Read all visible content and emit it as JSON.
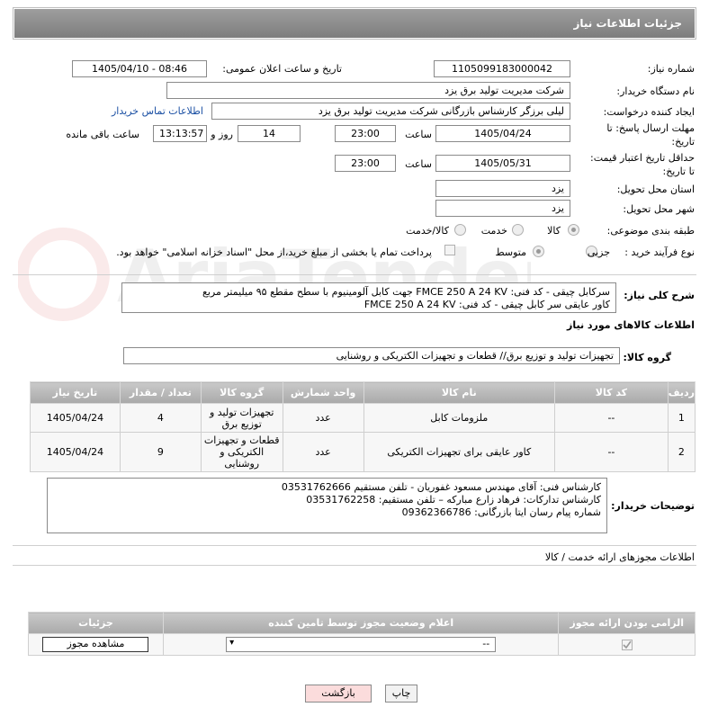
{
  "header": {
    "title": "جزئیات اطلاعات نیاز"
  },
  "fields": {
    "need_number_label": "شماره نیاز:",
    "need_number": "1105099183000042",
    "announce_label": "تاریخ و ساعت اعلان عمومی:",
    "announce_value": "1405/04/10 - 08:46",
    "buyer_org_label": "نام دستگاه خریدار:",
    "buyer_org": "شرکت مدیریت تولید برق یزد",
    "requester_label": "ایجاد کننده درخواست:",
    "requester": "لیلی برزگر کارشناس بازرگانی شرکت مدیریت تولید برق یزد",
    "contact_link": "اطلاعات تماس خریدار",
    "deadline_label_1": "مهلت ارسال پاسخ: تا",
    "deadline_label_2": "تاریخ:",
    "deadline_date": "1405/04/24",
    "time_label": "ساعت",
    "deadline_time": "23:00",
    "days": "14",
    "days_label": "روز و",
    "remaining": "13:13:57",
    "remaining_label": "ساعت باقی مانده",
    "validity_label_1": "حداقل تاریخ اعتبار قیمت:",
    "validity_label_2": "تا تاریخ:",
    "validity_date": "1405/05/31",
    "validity_time": "23:00",
    "province_label": "استان محل تحویل:",
    "province": "یزد",
    "city_label": "شهر محل تحویل:",
    "city": "یزد",
    "category_label": "طبقه بندی موضوعی:",
    "category_options": [
      "کالا",
      "خدمت",
      "کالا/خدمت"
    ],
    "process_label": "نوع فرآیند خرید :",
    "process_options": [
      "جزیی",
      "متوسط"
    ],
    "payment_note": "پرداخت تمام یا بخشی از مبلغ خرید،از محل \"اسناد خزانه اسلامی\" خواهد بود.",
    "description_label": "شرح کلی نیاز:",
    "description_line1": "سرکابل چیقی - کد فنی: FMCE 250 A 24 KV جهت کابل آلومینیوم با سطح مقطع ۹۵ میلیمتر مربع",
    "description_line2": "کاور عایقی سر کابل چیقی - کد فنی: FMCE 250 A 24 KV"
  },
  "goods": {
    "title": "اطلاعات کالاهای مورد نیاز",
    "group_label": "گروه کالا:",
    "group_value": "تجهیزات تولید و توزیع برق// قطعات و تجهیزات الکتریکی و روشنایی",
    "columns": [
      "ردیف",
      "کد کالا",
      "نام کالا",
      "واحد شمارش",
      "گروه کالا",
      "تعداد / مقدار",
      "تاریخ نیاز"
    ],
    "rows": [
      {
        "idx": "1",
        "code": "--",
        "name": "ملزومات کابل",
        "unit": "عدد",
        "group": "تجهیزات تولید و توزیع برق",
        "qty": "4",
        "date": "1405/04/24"
      },
      {
        "idx": "2",
        "code": "--",
        "name": "کاور عایقی برای تجهیزات الکتریکی",
        "unit": "عدد",
        "group": "قطعات و تجهیزات الکتریکی و روشنایی",
        "qty": "9",
        "date": "1405/04/24"
      }
    ]
  },
  "buyer_notes": {
    "label": "توضیحات خریدار:",
    "line1": "کارشناس فنی: آقای مهندس مسعود غفوریان - تلفن مستقیم 03531762666",
    "line2": "کارشناس تدارکات: فرهاد زارع مبارکه –  تلفن مستقیم: 03531762258",
    "line3": "شماره پیام رسان ایتا بازرگانی: 09362366786"
  },
  "permits": {
    "title": "اطلاعات مجوزهای ارائه خدمت / کالا",
    "columns": [
      "الزامی بودن ارائه مجوز",
      "اعلام وضعیت مجوز توسط تامین کننده",
      "جزئیات"
    ],
    "status_value": "--",
    "view_button": "مشاهده مجوز"
  },
  "actions": {
    "print": "چاپ",
    "back": "بازگشت"
  },
  "watermark": "AriaTender.neT"
}
